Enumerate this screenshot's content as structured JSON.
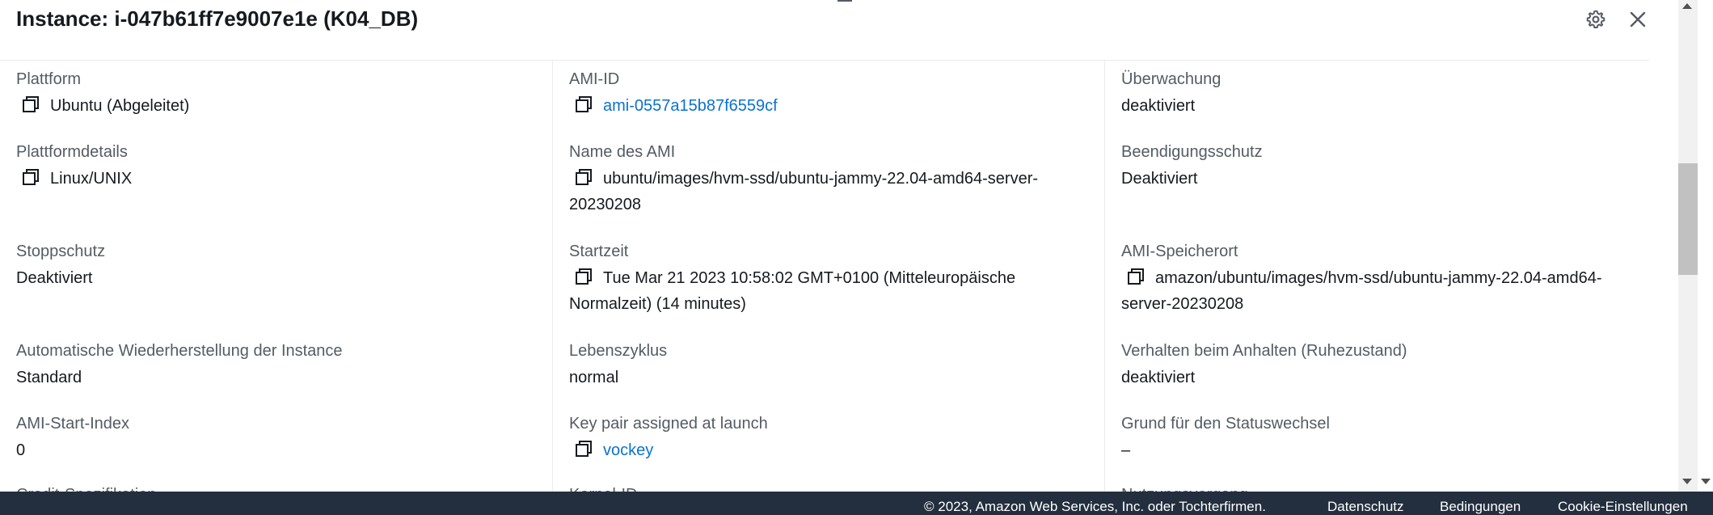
{
  "header": {
    "title": "Instance: i-047b61ff7e9007e1e (K04_DB)",
    "settings_icon": "gear-icon",
    "close_icon": "close-icon"
  },
  "details": {
    "col1": [
      {
        "label": "Plattform",
        "value": "Ubuntu (Abgeleitet)",
        "copy": true
      },
      {
        "label": "Plattformdetails",
        "value": "Linux/UNIX",
        "copy": true
      },
      {
        "label": "Stoppschutz",
        "value": "Deaktiviert"
      },
      {
        "label": "Automatische Wiederherstellung der Instance",
        "value": "Standard"
      },
      {
        "label": "AMI-Start-Index",
        "value": "0"
      },
      {
        "label": "Credit-Spezifikation"
      }
    ],
    "col2": [
      {
        "label": "AMI-ID",
        "value": "ami-0557a15b87f6559cf",
        "copy": true,
        "link": true
      },
      {
        "label": "Name des AMI",
        "value": "ubuntu/images/hvm-ssd/ubuntu-jammy-22.04-amd64-server-20230208",
        "copy": true
      },
      {
        "label": "Startzeit",
        "value": "Tue Mar 21 2023 10:58:02 GMT+0100 (Mitteleuropäische Normalzeit) (14 minutes)",
        "copy": true
      },
      {
        "label": "Lebenszyklus",
        "value": "normal"
      },
      {
        "label": "Key pair assigned at launch",
        "value": "vockey",
        "copy": true,
        "link": true
      },
      {
        "label": "Kernel-ID"
      }
    ],
    "col3": [
      {
        "label": "Überwachung",
        "value": "deaktiviert"
      },
      {
        "label": "Beendigungsschutz",
        "value": "Deaktiviert"
      },
      {
        "label": "AMI-Speicherort",
        "value": "amazon/ubuntu/images/hvm-ssd/ubuntu-jammy-22.04-amd64-server-20230208",
        "copy": true
      },
      {
        "label": "Verhalten beim Anhalten (Ruhezustand)",
        "value": "deaktiviert"
      },
      {
        "label": "Grund für den Statuswechsel",
        "value": "–"
      },
      {
        "label": "Nutzungsvorgang"
      }
    ]
  },
  "footer": {
    "copyright": "© 2023, Amazon Web Services, Inc. oder Tochterfirmen.",
    "privacy": "Datenschutz",
    "terms": "Bedingungen",
    "cookies": "Cookie-Einstellungen"
  },
  "colors": {
    "link": "#0972d3",
    "label": "#545b64",
    "text": "#16191f",
    "footer_bg": "#232f3e"
  }
}
